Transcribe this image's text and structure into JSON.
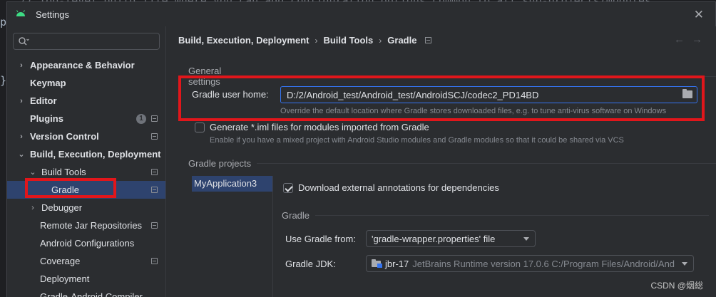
{
  "background": {
    "code_line": "  // Top-level build file where you can add configuration options common to all sub-projects/modules.",
    "gutter_1": "p",
    "gutter_2": "}"
  },
  "window": {
    "title": "Settings",
    "close_label": "✕"
  },
  "search": {
    "placeholder": ""
  },
  "sidebar": {
    "items": [
      {
        "label": "Appearance & Behavior",
        "arrow": "›",
        "bold": true
      },
      {
        "label": "Keymap",
        "bold": true
      },
      {
        "label": "Editor",
        "arrow": "›",
        "bold": true
      },
      {
        "label": "Plugins",
        "bold": true,
        "badge": "1"
      },
      {
        "label": "Version Control",
        "arrow": "›",
        "bold": true
      },
      {
        "label": "Build, Execution, Deployment",
        "arrow": "⌄",
        "bold": true
      },
      {
        "label": "Build Tools",
        "arrow": "⌄"
      },
      {
        "label": "Gradle",
        "selected": true
      },
      {
        "label": "Debugger",
        "arrow": "›"
      },
      {
        "label": "Remote Jar Repositories"
      },
      {
        "label": "Android Configurations"
      },
      {
        "label": "Coverage"
      },
      {
        "label": "Deployment"
      },
      {
        "label": "Gradle-Android Compiler"
      }
    ]
  },
  "breadcrumb": {
    "part1": "Build, Execution, Deployment",
    "part2": "Build Tools",
    "part3": "Gradle",
    "separator": "›"
  },
  "nav": {
    "back": "←",
    "forward": "→"
  },
  "general_settings": {
    "title": "General settings",
    "gradle_user_home_label": "Gradle user home:",
    "gradle_user_home_value": "D:/2/Android_test/Android_test/AndroidSCJ/codec2_PD14BD",
    "gradle_user_home_hint": "Override the default location where Gradle stores downloaded files, e.g. to tune anti-virus software on Windows",
    "generate_iml_label": "Generate *.iml files for modules imported from Gradle",
    "generate_iml_checked": false,
    "generate_iml_hint": "Enable if you have a mixed project with Android Studio modules and Gradle modules so that it could be shared via VCS"
  },
  "gradle_projects": {
    "title": "Gradle projects",
    "projects": [
      "MyApplication3"
    ],
    "download_annotations_label": "Download external annotations for dependencies",
    "download_annotations_checked": true,
    "gradle_section_title": "Gradle",
    "use_gradle_from_label": "Use Gradle from:",
    "use_gradle_from_value": "'gradle-wrapper.properties' file",
    "gradle_jdk_label": "Gradle JDK:",
    "gradle_jdk_name": "jbr-17",
    "gradle_jdk_detail": "JetBrains Runtime version 17.0.6 C:/Program Files/Android/And"
  },
  "watermark": "CSDN @烟総",
  "colors": {
    "accent": "#3574f0",
    "selection": "#2e436e",
    "annotation": "#e1161b"
  }
}
